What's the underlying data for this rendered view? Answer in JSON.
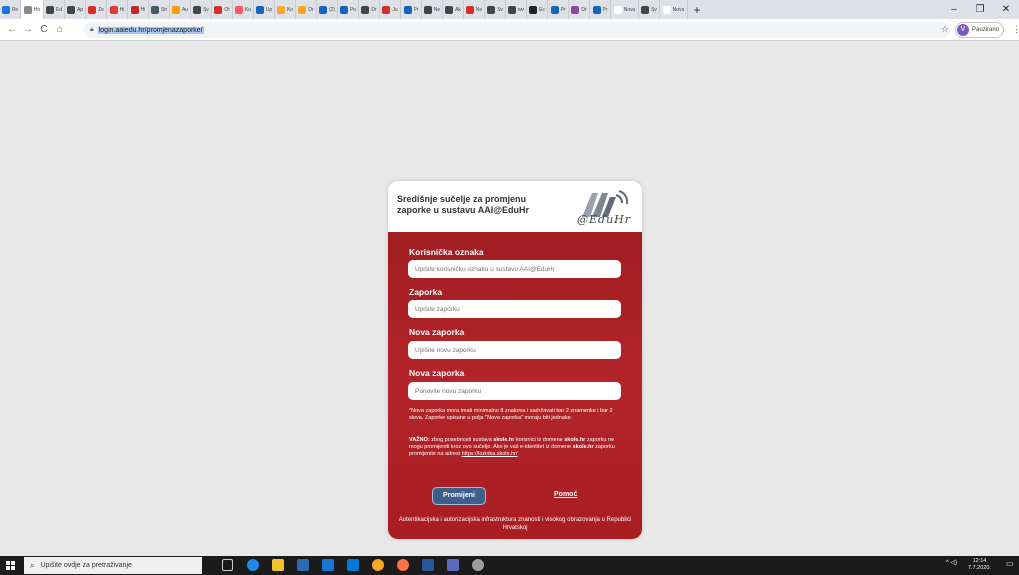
{
  "browser": {
    "tabs": [
      {
        "label": "Re",
        "color": "#1a73e8"
      },
      {
        "label": "Ho",
        "color": "#888888"
      },
      {
        "label": "Ed",
        "color": "#444444"
      },
      {
        "label": "Ap",
        "color": "#444444"
      },
      {
        "label": "Ze",
        "color": "#d93025"
      },
      {
        "label": "Hi",
        "color": "#e53935"
      },
      {
        "label": "Hi",
        "color": "#c62828"
      },
      {
        "label": "Str",
        "color": "#455a64"
      },
      {
        "label": "Au",
        "color": "#f4a300"
      },
      {
        "label": "Sv",
        "color": "#444444"
      },
      {
        "label": "Ot",
        "color": "#d32f2f"
      },
      {
        "label": "Ko",
        "color": "#ff5a5f"
      },
      {
        "label": "Up",
        "color": "#1565c0"
      },
      {
        "label": "Ko",
        "color": "#f9a825"
      },
      {
        "label": "Dr",
        "color": "#f9a825"
      },
      {
        "label": "(2)",
        "color": "#1565c0"
      },
      {
        "label": "Po",
        "color": "#1565c0"
      },
      {
        "label": "Dr",
        "color": "#444444"
      },
      {
        "label": "Ju",
        "color": "#d32f2f"
      },
      {
        "label": "Pr",
        "color": "#1565c0"
      },
      {
        "label": "Ne",
        "color": "#444444"
      },
      {
        "label": "Ak",
        "color": "#444444"
      },
      {
        "label": "Ne",
        "color": "#d32f2f"
      },
      {
        "label": "Sv",
        "color": "#444444"
      },
      {
        "label": "wv",
        "color": "#444444"
      },
      {
        "label": "Ec",
        "color": "#222222"
      },
      {
        "label": "Pr",
        "color": "#1565c0"
      },
      {
        "label": "Dr",
        "color": "#8e44ad"
      },
      {
        "label": "Pr",
        "color": "#1565c0"
      },
      {
        "label": "Nova",
        "color": "#ffffff"
      },
      {
        "label": "Sv",
        "color": "#444444"
      },
      {
        "label": "Nova",
        "color": "#ffffff"
      }
    ],
    "new_tab": "+",
    "minimize": "–",
    "restore": "❐",
    "close": "✕",
    "url": "login.aaiedu.hr/promjenazaporke/",
    "profile_initial": "V",
    "profile_status": "Pauzirano"
  },
  "form": {
    "title": "Središnje sučelje za promjenu zaporke u sustavu AAI@EduHr",
    "logo_text": "@EduHr",
    "fields": [
      {
        "label": "Korisnička oznaka",
        "placeholder": "Upišite korisničku oznaku u sustavu AAI@EduHr"
      },
      {
        "label": "Zaporka",
        "placeholder": "Upišite zaporku"
      },
      {
        "label": "Nova zaporka",
        "placeholder": "Upišite novu zaporku"
      },
      {
        "label": "Nova zaporka",
        "placeholder": "Ponovite novu zaporku"
      }
    ],
    "note_requirements": "*Nova zaporka mora imati minimalno 8 znakova i sadržavati bar 2 znamenke i bar 2 slova. Zaporke upisane u polja \"Nova zaporka\" moraju biti jednake.",
    "note_important_prefix": "VAŽNO:",
    "note_important_text1": " zbog posebnosti sustava ",
    "note_important_domain1": "skole.hr",
    "note_important_text2": " korisnici iz domene ",
    "note_important_domain2": "skole.hr",
    "note_important_text3": " zaporku ne mogu promijeniti kroz ovo sučelje. Ako je vaš e-identitet iz domene ",
    "note_important_domain3": "skole.hr",
    "note_important_text4": " zaporku promijenite na adresi ",
    "note_important_link": "https://lozinka.skole.hr/",
    "submit_label": "Promijeni",
    "help_label": "Pomoć",
    "footer": "Autentikacijska i autorizacijska infrastruktura znanosti i visokog obrazovanja u Republici Hrvatskoj"
  },
  "taskbar": {
    "search_placeholder": "Upišite ovdje za pretraživanje",
    "tray": "^ ◁)",
    "time": "12:14",
    "date": "7.7.2020."
  }
}
